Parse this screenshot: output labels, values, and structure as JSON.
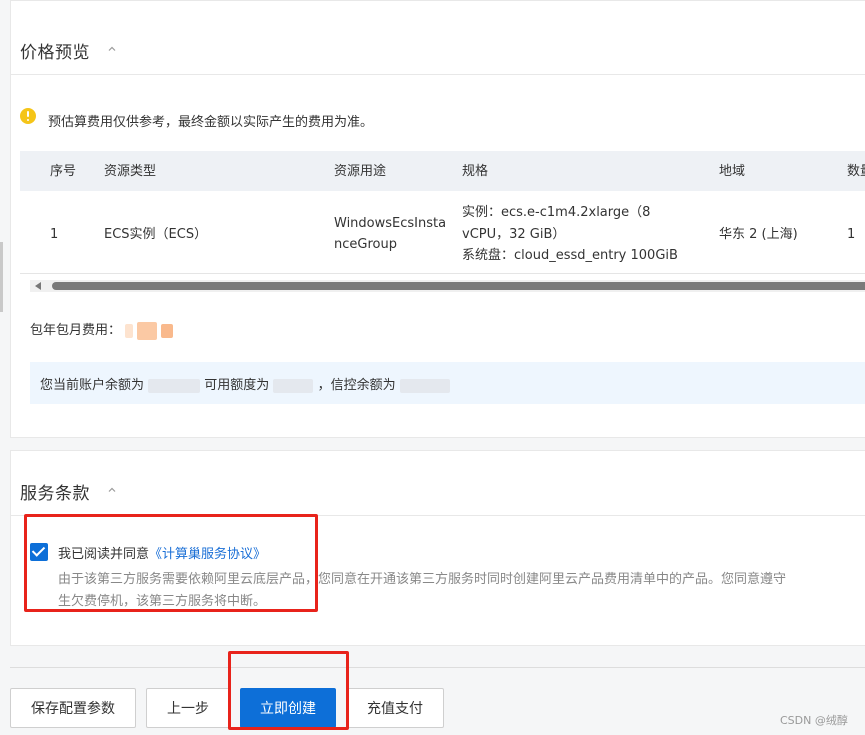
{
  "price_panel": {
    "title": "价格预览",
    "notice": "预估算费用仅供参考，最终金额以实际产生的费用为准。",
    "table": {
      "headers": [
        "序号",
        "资源类型",
        "资源用途",
        "规格",
        "地域",
        "数量"
      ],
      "row": {
        "index": "1",
        "resource_type": "ECS实例（ECS）",
        "usage_line1": "WindowsEcsInsta",
        "usage_line2": "nceGroup",
        "spec_line1": "实例：ecs.e-c1m4.2xlarge（8",
        "spec_line2": "vCPU，32 GiB）",
        "spec_line3": "系统盘：cloud_essd_entry 100GiB",
        "region": "华东 2 (上海)",
        "quantity": "1"
      }
    },
    "fee_label": "包年包月费用：",
    "balance": {
      "account_label": "您当前账户余额为",
      "available_label": "可用额度为",
      "credit_label": "，信控余额为"
    }
  },
  "terms_panel": {
    "title": "服务条款",
    "agree_prefix": "我已阅读并同意",
    "agree_link": "《计算巢服务协议》",
    "description": "由于该第三方服务需要依赖阿里云底层产品，您同意在开通该第三方服务时同时创建阿里云产品费用清单中的产品。您同意遵守",
    "description_line2": "生欠费停机，该第三方服务将中断。",
    "checked": true
  },
  "actions": {
    "save_config": "保存配置参数",
    "previous": "上一步",
    "create_now": "立即创建",
    "recharge": "充值支付"
  },
  "watermark": "CSDN @绒醇",
  "colors": {
    "primary": "#0d6fd8",
    "link": "#1a6fd6",
    "highlight_red": "#e8231b",
    "warning": "#f5c518",
    "info_bg": "#eef6fe"
  }
}
